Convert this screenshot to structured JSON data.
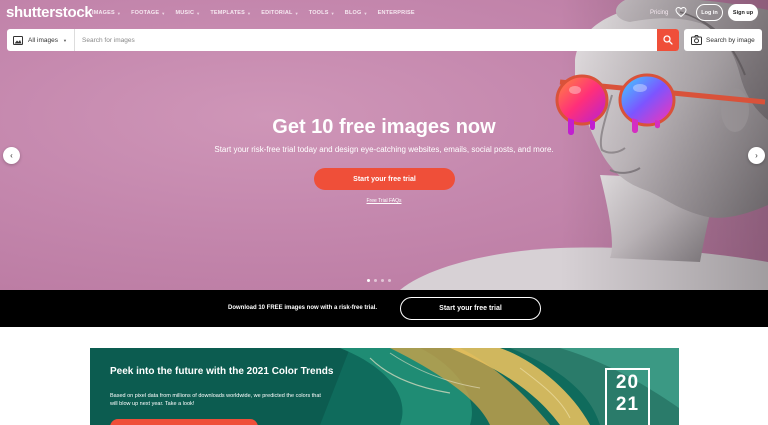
{
  "brand": {
    "logo": "shutterstock"
  },
  "nav": {
    "menu": [
      {
        "label": "IMAGES",
        "has_caret": true
      },
      {
        "label": "FOOTAGE",
        "has_caret": true
      },
      {
        "label": "MUSIC",
        "has_caret": true
      },
      {
        "label": "TEMPLATES",
        "has_caret": true
      },
      {
        "label": "EDITORIAL",
        "has_caret": true
      },
      {
        "label": "TOOLS",
        "has_caret": true
      },
      {
        "label": "BLOG",
        "has_caret": true
      },
      {
        "label": "ENTERPRISE",
        "has_caret": false
      }
    ],
    "pricing": "Pricing",
    "login": "Log in",
    "signup": "Sign up"
  },
  "search": {
    "type_selected": "All images",
    "placeholder": "Search for images",
    "search_by_image": "Search by image"
  },
  "hero": {
    "title": "Get 10 free images now",
    "subtitle": "Start your risk-free trial today and design eye-catching websites, emails, social posts, and more.",
    "cta": "Start your free trial",
    "faq_link": "Free Trial FAQs",
    "carousel_slide_count": 4,
    "carousel_active_index": 0
  },
  "promo_bar": {
    "text": "Download 10 FREE images now with a risk-free trial.",
    "cta": "Start your free trial"
  },
  "trends_banner": {
    "title": "Peek into the future with the 2021 Color Trends",
    "description": "Based on pixel data from millions of downloads worldwide, we predicted the colors that will blow up next year. Take a look!",
    "year_top": "20",
    "year_bottom": "21"
  },
  "colors": {
    "accent": "#ef4f39",
    "hero_bg": "#c487ad",
    "promo_bg": "#000000",
    "trends_bg": "#0f6b5c"
  },
  "icons": {
    "heart": "heart-icon",
    "image": "image-icon",
    "search": "search-icon",
    "camera": "camera-search-icon",
    "left": "chevron-left-icon",
    "right": "chevron-right-icon"
  }
}
